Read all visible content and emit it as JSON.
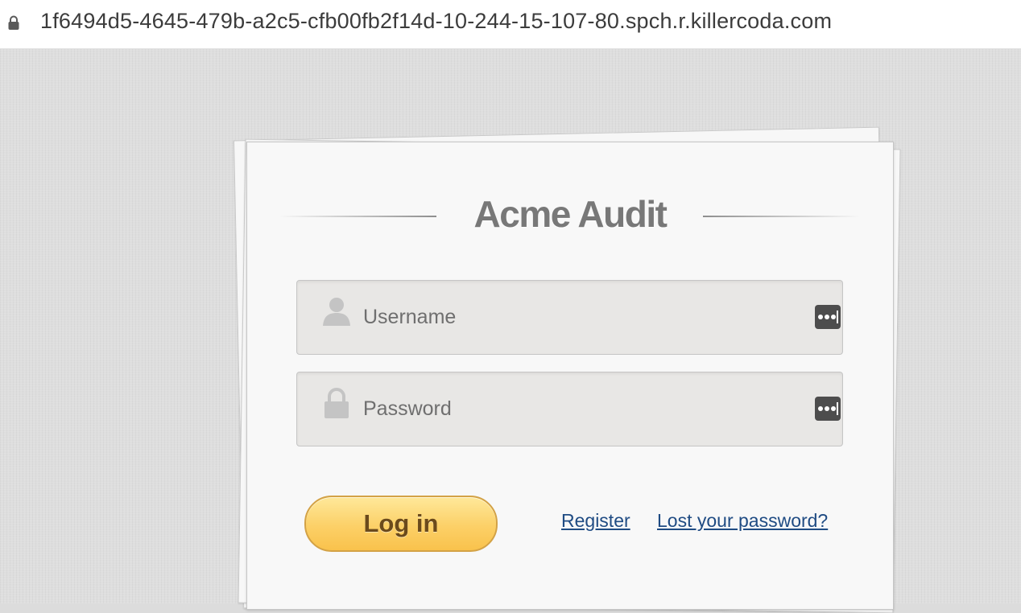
{
  "browser": {
    "url": "1f6494d5-4645-479b-a2c5-cfb00fb2f14d-10-244-15-107-80.spch.r.killercoda.com",
    "lock_icon": "lock-icon"
  },
  "login": {
    "title": "Acme Audit",
    "username": {
      "placeholder": "Username",
      "value": "",
      "icon": "user-icon"
    },
    "password": {
      "placeholder": "Password",
      "value": "",
      "icon": "padlock-icon"
    },
    "password_manager_icon": "password-manager-icon",
    "login_label": "Log in",
    "register_label": "Register",
    "lost_password_label": "Lost your password?"
  },
  "colors": {
    "button_gold": "#fcd067",
    "link_blue": "#1f4b83",
    "title_gray": "#787878"
  }
}
